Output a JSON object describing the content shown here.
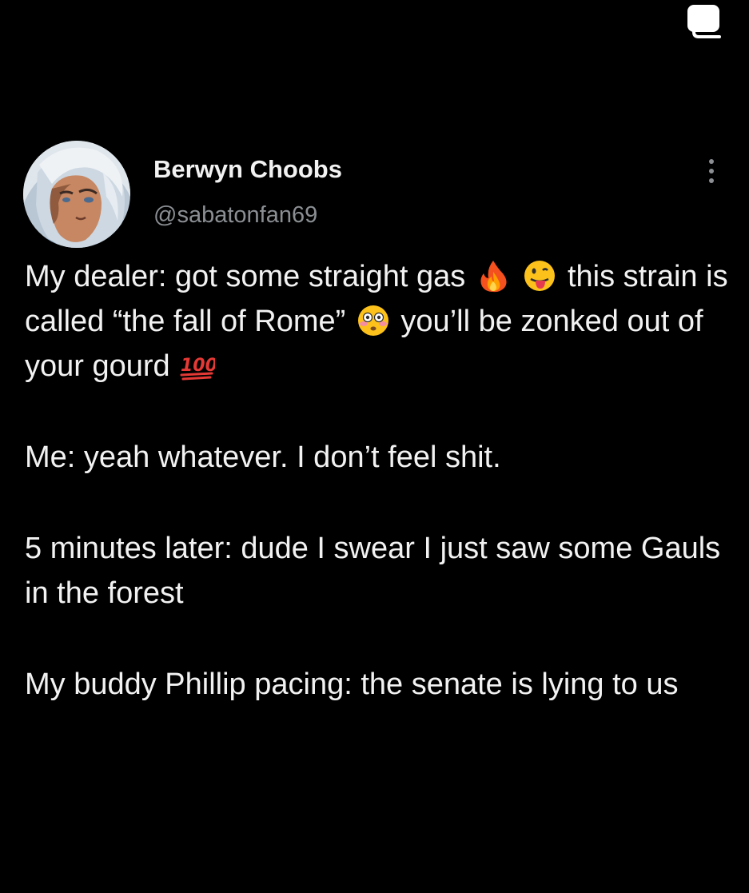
{
  "author": {
    "display_name": "Berwyn Choobs",
    "handle": "@sabatonfan69"
  },
  "icons": {
    "copy": "copy-icon",
    "more": "more-options-icon",
    "emoji_fire": "fire-emoji",
    "emoji_tongue": "tongue-out-face-emoji",
    "emoji_flushed": "flushed-face-emoji",
    "emoji_hundred": "hundred-points-emoji"
  },
  "tweet": {
    "p1_part1": "My dealer: got some straight gas",
    "p1_part2": "this strain is called “the fall of Rome”",
    "p1_part3": "you’ll be zonked out of your gourd",
    "p2": "Me: yeah whatever. I don’t feel shit.",
    "p3": "5 minutes later: dude I swear I just saw some Gauls in the forest",
    "p4": "My buddy Phillip pacing: the senate is lying to us"
  },
  "colors": {
    "background": "#000000",
    "text": "#f2f2f2",
    "secondary_text": "#8b8f93"
  }
}
